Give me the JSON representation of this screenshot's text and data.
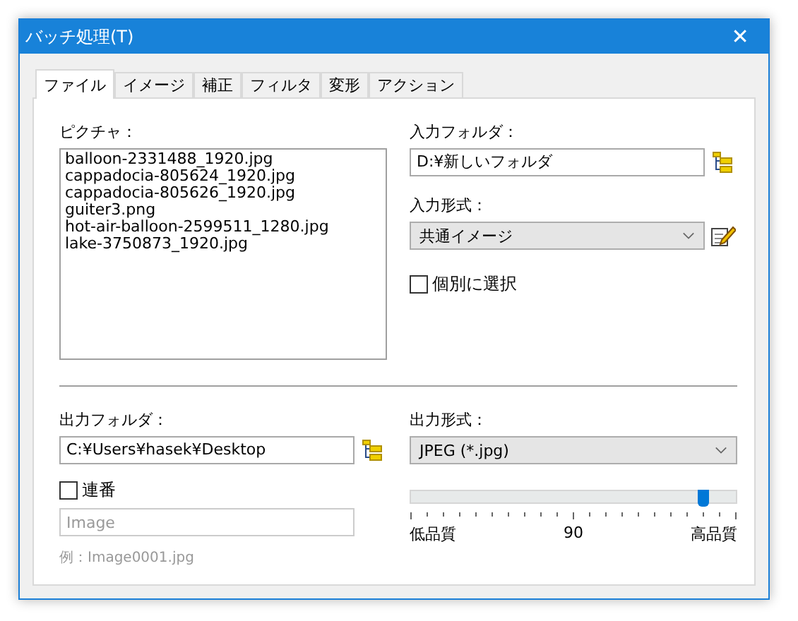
{
  "window": {
    "title": "バッチ処理(T)",
    "close": "✕"
  },
  "tabs": [
    {
      "label": "ファイル",
      "selected": true
    },
    {
      "label": "イメージ",
      "selected": false
    },
    {
      "label": "補正",
      "selected": false
    },
    {
      "label": "フィルタ",
      "selected": false
    },
    {
      "label": "変形",
      "selected": false
    },
    {
      "label": "アクション",
      "selected": false
    }
  ],
  "pictures": {
    "label": "ピクチャ：",
    "items": [
      "balloon-2331488_1920.jpg",
      "cappadocia-805624_1920.jpg",
      "cappadocia-805626_1920.jpg",
      "guiter3.png",
      "hot-air-balloon-2599511_1280.jpg",
      "lake-3750873_1920.jpg"
    ]
  },
  "input_folder": {
    "label": "入力フォルダ：",
    "value": "D:¥新しいフォルダ"
  },
  "input_format": {
    "label": "入力形式：",
    "value": "共通イメージ"
  },
  "individual_select": {
    "label": "個別に選択",
    "checked": false
  },
  "output_folder": {
    "label": "出力フォルダ：",
    "value": "C:¥Users¥hasek¥Desktop"
  },
  "serial": {
    "label": "連番",
    "checked": false,
    "placeholder": "Image",
    "example": "例：Image0001.jpg"
  },
  "output_format": {
    "label": "出力形式：",
    "value": "JPEG (*.jpg)"
  },
  "quality": {
    "level": 0.9,
    "min_label": "低品質",
    "reading": "90",
    "max_label": "高品質"
  }
}
